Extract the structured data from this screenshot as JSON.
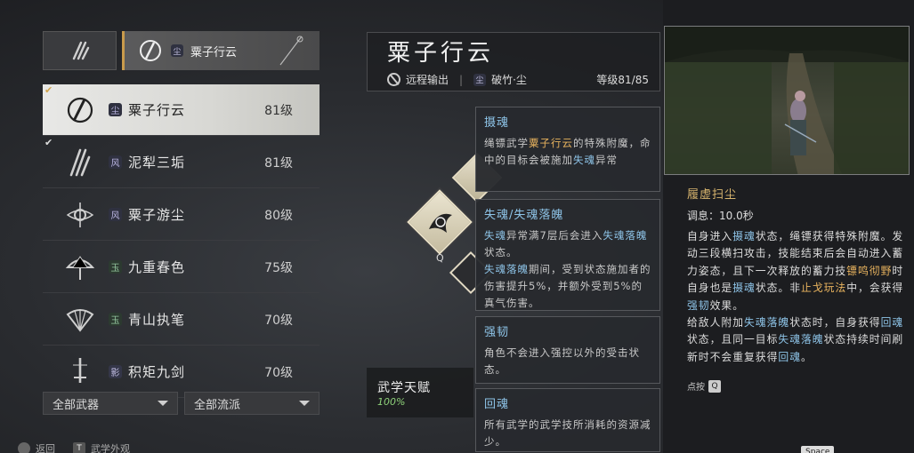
{
  "header": {
    "selected_tab_label": "粟子行云",
    "selected_tab_badge": "尘"
  },
  "weapons": [
    {
      "name": "粟子行云",
      "level": "81级",
      "badge": "尘",
      "selected": true,
      "equipped": true,
      "icon": "rope-dart-icon"
    },
    {
      "name": "泥犁三垢",
      "level": "81级",
      "badge": "风",
      "selected": false,
      "equipped": true,
      "icon": "claw-blades-icon"
    },
    {
      "name": "粟子游尘",
      "level": "80级",
      "badge": "风",
      "selected": false,
      "equipped": false,
      "icon": "orb-spear-icon"
    },
    {
      "name": "九重春色",
      "level": "75级",
      "badge": "玉",
      "selected": false,
      "equipped": false,
      "icon": "umbrella-icon"
    },
    {
      "name": "青山执笔",
      "level": "70级",
      "badge": "玉",
      "selected": false,
      "equipped": false,
      "icon": "fan-icon"
    },
    {
      "name": "积矩九剑",
      "level": "70级",
      "badge": "影",
      "selected": false,
      "equipped": false,
      "icon": "sword-icon"
    }
  ],
  "filters": {
    "weapon": "全部武器",
    "school": "全部流派"
  },
  "bottom_hints": {
    "back": "返回",
    "back_key": "",
    "appearance": "武学外观",
    "appearance_key": "T"
  },
  "title": {
    "name": "粟子行云",
    "role": "远程输出",
    "path_badge": "尘",
    "path": "破竹·尘",
    "level": "等级81/85"
  },
  "skill_key": "Q",
  "tooltips": [
    {
      "title": "摄魂",
      "segments": [
        {
          "t": "绳镖武学",
          "c": ""
        },
        {
          "t": "粟子行云",
          "c": "gold"
        },
        {
          "t": "的特殊附魔，命中的目标会被施加",
          "c": ""
        },
        {
          "t": "失魂",
          "c": "blue"
        },
        {
          "t": "异常",
          "c": ""
        }
      ]
    },
    {
      "title": "失魂/失魂落魄",
      "segments": [
        {
          "t": "失魂",
          "c": "blue"
        },
        {
          "t": "异常满7层后会进入",
          "c": ""
        },
        {
          "t": "失魂落魄",
          "c": "blue"
        },
        {
          "t": "状态。",
          "c": ""
        },
        {
          "t": "失魂落魄",
          "c": "blue",
          "br": true
        },
        {
          "t": "期间，受到状态施加者的伤害提升5%，并额外受到5%的真气伤害。",
          "c": ""
        }
      ]
    },
    {
      "title": "强韧",
      "segments": [
        {
          "t": "角色不会进入强控以外的受击状态。",
          "c": ""
        }
      ]
    },
    {
      "title": "回魂",
      "segments": [
        {
          "t": "所有武学的武学技所消耗的资源减少。",
          "c": ""
        }
      ]
    }
  ],
  "talent": {
    "title": "武学天赋",
    "percent": "100%"
  },
  "skill_detail": {
    "name": "履虚扫尘",
    "cooldown": "调息：10.0秒",
    "segments": [
      {
        "t": "自身进入",
        "c": ""
      },
      {
        "t": "摄魂",
        "c": "blue"
      },
      {
        "t": "状态，绳镖获得特殊附魔。发动三段横扫攻击，技能结束后会自动进入蓄力姿态，且下一次释放的蓄力技",
        "c": ""
      },
      {
        "t": "镖鸣彻野",
        "c": "gold"
      },
      {
        "t": "时自身也是",
        "c": ""
      },
      {
        "t": "摄魂",
        "c": "blue"
      },
      {
        "t": "状态。非",
        "c": ""
      },
      {
        "t": "止戈玩法",
        "c": "gold"
      },
      {
        "t": "中，会获得",
        "c": ""
      },
      {
        "t": "强韧",
        "c": "blue"
      },
      {
        "t": "效果。",
        "c": ""
      },
      {
        "t": "给敌人附加",
        "c": "",
        "br": true
      },
      {
        "t": "失魂落魄",
        "c": "blue"
      },
      {
        "t": "状态时，自身获得",
        "c": ""
      },
      {
        "t": "回魂",
        "c": "blue"
      },
      {
        "t": "状态，且同一目标",
        "c": ""
      },
      {
        "t": "失魂落魄",
        "c": "blue"
      },
      {
        "t": "状态持续时间刷新时不会重复获得",
        "c": ""
      },
      {
        "t": "回魂",
        "c": "blue"
      },
      {
        "t": "。",
        "c": ""
      }
    ],
    "press_hint": "点按",
    "press_key": "Q"
  },
  "space_hint": {
    "key": "Space",
    "label": ""
  },
  "colors": {
    "accent_gold": "#c99b4c",
    "highlight_blue": "#8ec4e8",
    "highlight_gold": "#e8b35e",
    "talent_green": "#8fd27a"
  }
}
